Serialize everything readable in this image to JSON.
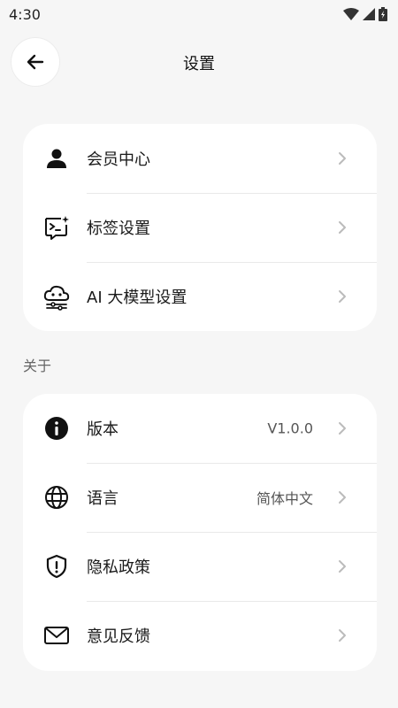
{
  "status": {
    "time": "4:30"
  },
  "header": {
    "title": "设置"
  },
  "group1": {
    "items": [
      {
        "label": "会员中心",
        "icon": "person-icon"
      },
      {
        "label": "标签设置",
        "icon": "tag-terminal-icon"
      },
      {
        "label": "AI 大模型设置",
        "icon": "ai-cloud-icon"
      }
    ]
  },
  "about": {
    "section_label": "关于",
    "items": [
      {
        "label": "版本",
        "value": "V1.0.0",
        "icon": "info-icon"
      },
      {
        "label": "语言",
        "value": "简体中文",
        "icon": "globe-icon"
      },
      {
        "label": "隐私政策",
        "icon": "shield-alert-icon"
      },
      {
        "label": "意见反馈",
        "icon": "mail-icon"
      }
    ]
  }
}
